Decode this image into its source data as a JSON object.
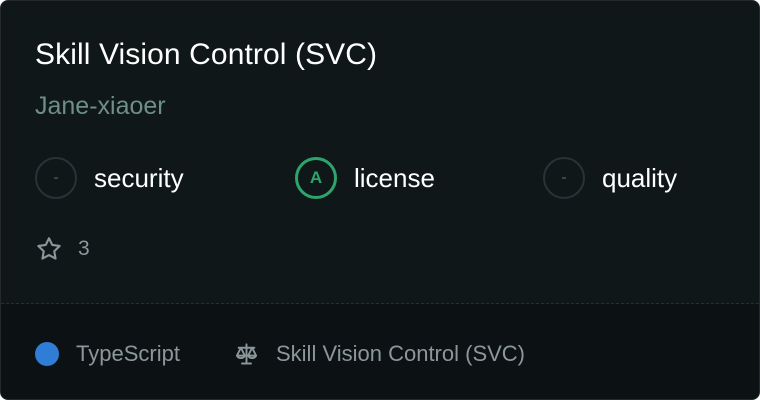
{
  "card": {
    "title": "Skill Vision Control (SVC)",
    "owner": "Jane-xiaoer",
    "scores": [
      {
        "label": "security",
        "grade": "-",
        "icon": "grade-badge-empty"
      },
      {
        "label": "license",
        "grade": "A",
        "icon": "grade-badge-a",
        "color": "#2ea46c"
      },
      {
        "label": "quality",
        "grade": "-",
        "icon": "grade-badge-empty"
      }
    ],
    "stars": {
      "icon": "star-outline-icon",
      "count": "3"
    },
    "footer": {
      "language": "TypeScript",
      "language_color": "#2f7dd6",
      "license_icon": "scale-icon",
      "license_name": "Skill Vision Control (SVC)"
    }
  },
  "colors": {
    "background": "#0f1719",
    "footer_background": "#0c1214",
    "title": "#ffffff",
    "owner": "#6e8f83",
    "muted": "#8b979b",
    "grade_a": "#2ea46c"
  }
}
